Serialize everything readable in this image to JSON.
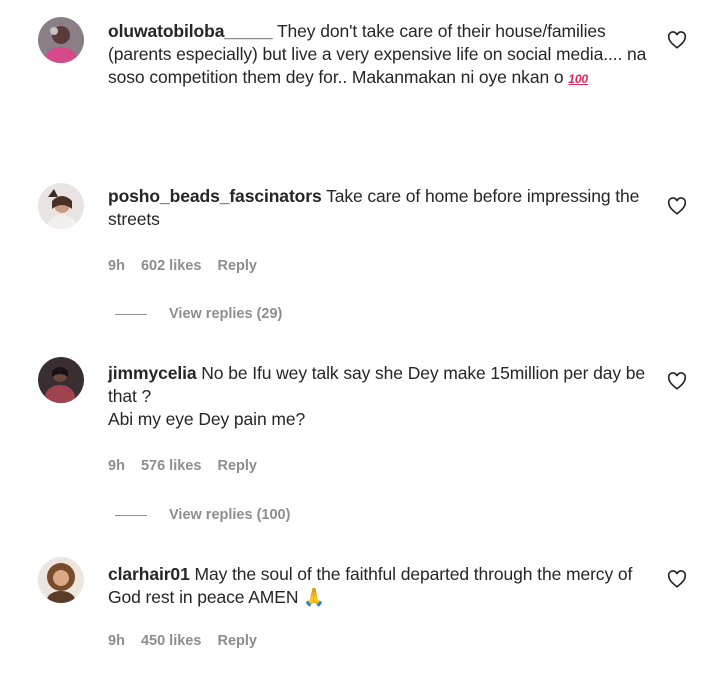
{
  "comments": [
    {
      "username": "oluwatobiloba_____",
      "text": "They don't take care of their house/families (parents especially) but live a very expensive life on social media.... na soso competition them dey for.. Makanmakan ni oye nkan o",
      "emoji": "💯",
      "emoji_label": "100"
    },
    {
      "username": "posho_beads_fascinators",
      "text": "Take care of home before impressing the streets",
      "time": "9h",
      "likes": "602 likes",
      "reply": "Reply",
      "view_replies": "View replies (29)"
    },
    {
      "username": "jimmycelia",
      "text_line1": "No be Ifu wey talk say she Dey make 15million per day be that ?",
      "text_line2": "Abi my eye Dey pain me?",
      "time": "9h",
      "likes": "576 likes",
      "reply": "Reply",
      "view_replies": "View replies (100)"
    },
    {
      "username": "clarhair01",
      "text": "May the soul of the faithful departed through the mercy of God rest in peace AMEN",
      "emoji": "🙏",
      "time": "9h",
      "likes": "450 likes",
      "reply": "Reply"
    }
  ],
  "icons": {
    "heart": "heart-outline-icon"
  },
  "colors": {
    "text": "#262626",
    "meta": "#8e8e8e",
    "background": "#ffffff"
  }
}
